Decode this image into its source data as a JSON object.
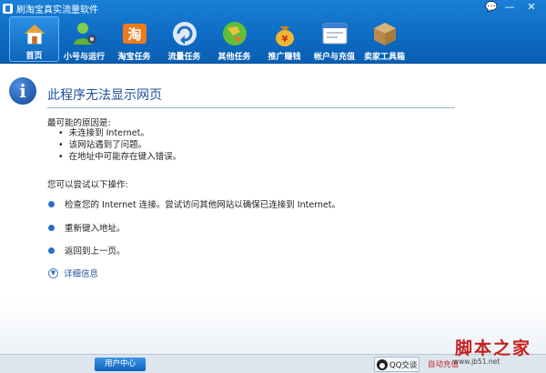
{
  "window": {
    "title": "刷淘宝真实流量软件",
    "controls": [
      "💬",
      "—",
      "✕"
    ]
  },
  "toolbar": [
    {
      "label": "首页",
      "icon": "home-icon",
      "active": true
    },
    {
      "label": "小号与运行",
      "icon": "user-gear-icon",
      "active": false
    },
    {
      "label": "淘宝任务",
      "icon": "taobao-icon",
      "active": false
    },
    {
      "label": "流量任务",
      "icon": "refresh-icon",
      "active": false
    },
    {
      "label": "其他任务",
      "icon": "globe-icon",
      "active": false
    },
    {
      "label": "推广赚钱",
      "icon": "money-bag-icon",
      "active": false
    },
    {
      "label": "帐户与充值",
      "icon": "browser-window-icon",
      "active": false
    },
    {
      "label": "卖家工具箱",
      "icon": "box-icon",
      "active": false
    }
  ],
  "page": {
    "title": "此程序无法显示网页",
    "reasons_heading": "最可能的原因是:",
    "reasons": [
      "未连接到 Internet。",
      "该网站遇到了问题。",
      "在地址中可能存在键入错误。"
    ],
    "try_heading": "您可以尝试以下操作:",
    "actions": [
      "检查您的 Internet 连接。尝试访问其他网站以确保已连接到 Internet。",
      "重新键入地址。",
      "返回到上一页。"
    ],
    "details": "详细信息"
  },
  "bottom": {
    "user_center": "用户中心",
    "qq": "QQ交谈",
    "recharge": "自动充值",
    "watermark": "脚本之家",
    "watermark_url": "www.jb51.net"
  }
}
